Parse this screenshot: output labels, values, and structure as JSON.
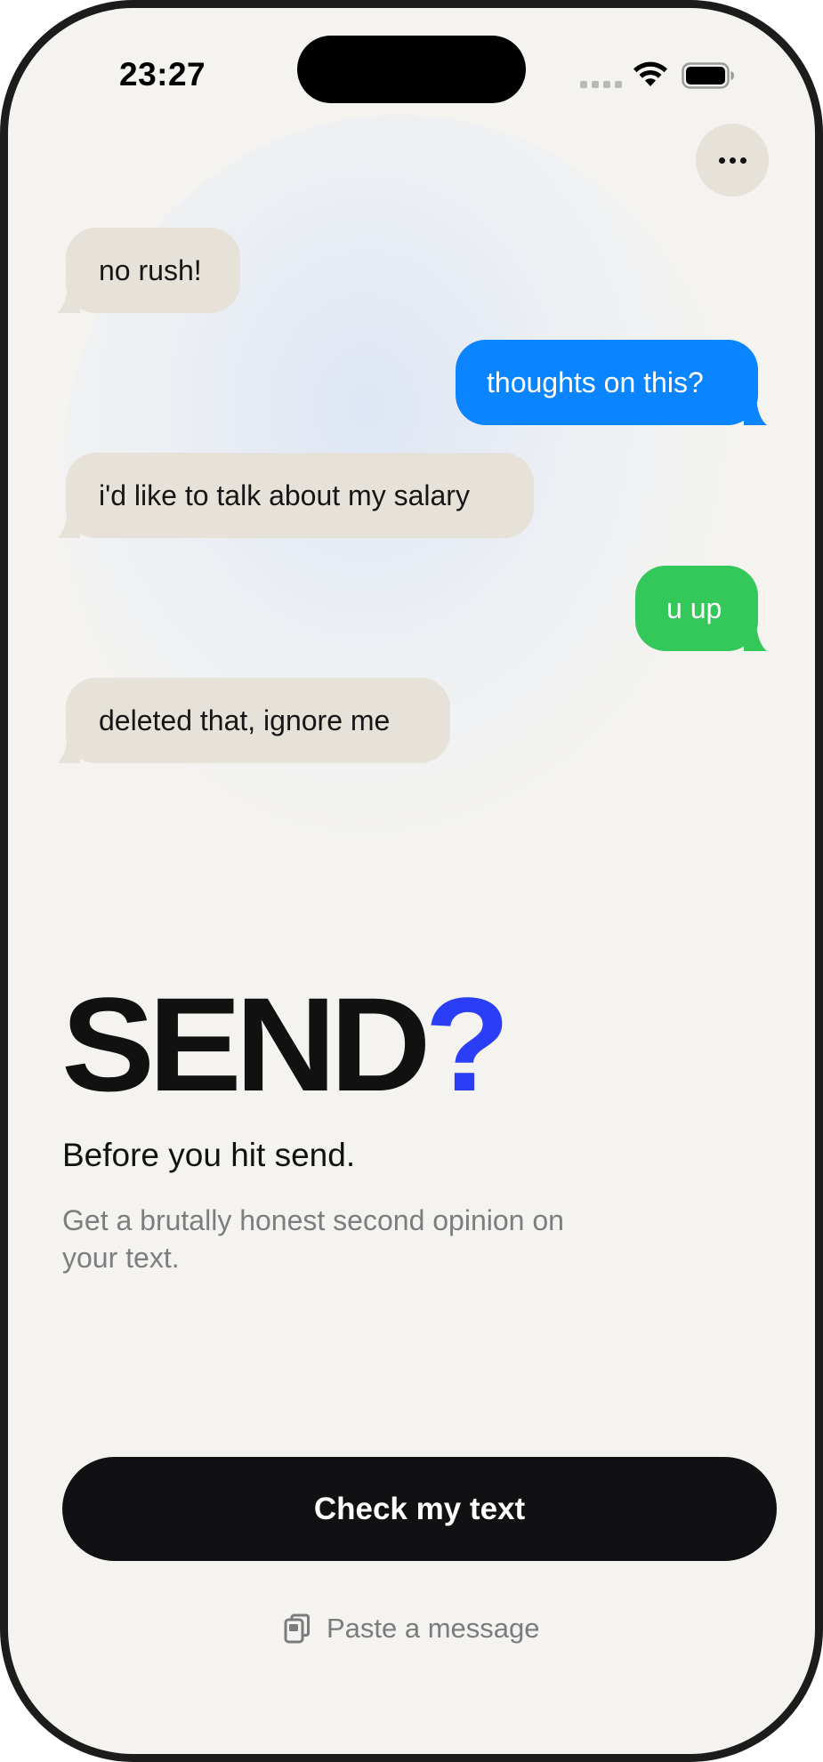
{
  "status_bar": {
    "time": "23:27",
    "signal_icon": "cellular-signal-icon",
    "wifi_icon": "wifi-icon",
    "battery_icon": "battery-icon"
  },
  "header": {
    "more_icon": "ellipsis-icon"
  },
  "messages": [
    {
      "text": "no rush!",
      "side": "incoming",
      "color": "#e6e1d9"
    },
    {
      "text": "thoughts on this?",
      "side": "outgoing",
      "color": "#0a84ff"
    },
    {
      "text": "i'd like to talk about my salary",
      "side": "incoming",
      "color": "#e6e1d9"
    },
    {
      "text": "u up",
      "side": "outgoing",
      "color": "#34c759"
    },
    {
      "text": "deleted that, ignore me",
      "side": "incoming",
      "color": "#e6e1d9"
    }
  ],
  "hero": {
    "word": "SEND",
    "mark": "?",
    "mark_color": "#2a3ff5"
  },
  "subtitle": "Before you hit send.",
  "description": "Get a brutally honest second opinion on your text.",
  "primary_button": {
    "label": "Check my text"
  },
  "paste": {
    "label": "Paste a message",
    "icon": "clipboard-icon"
  }
}
